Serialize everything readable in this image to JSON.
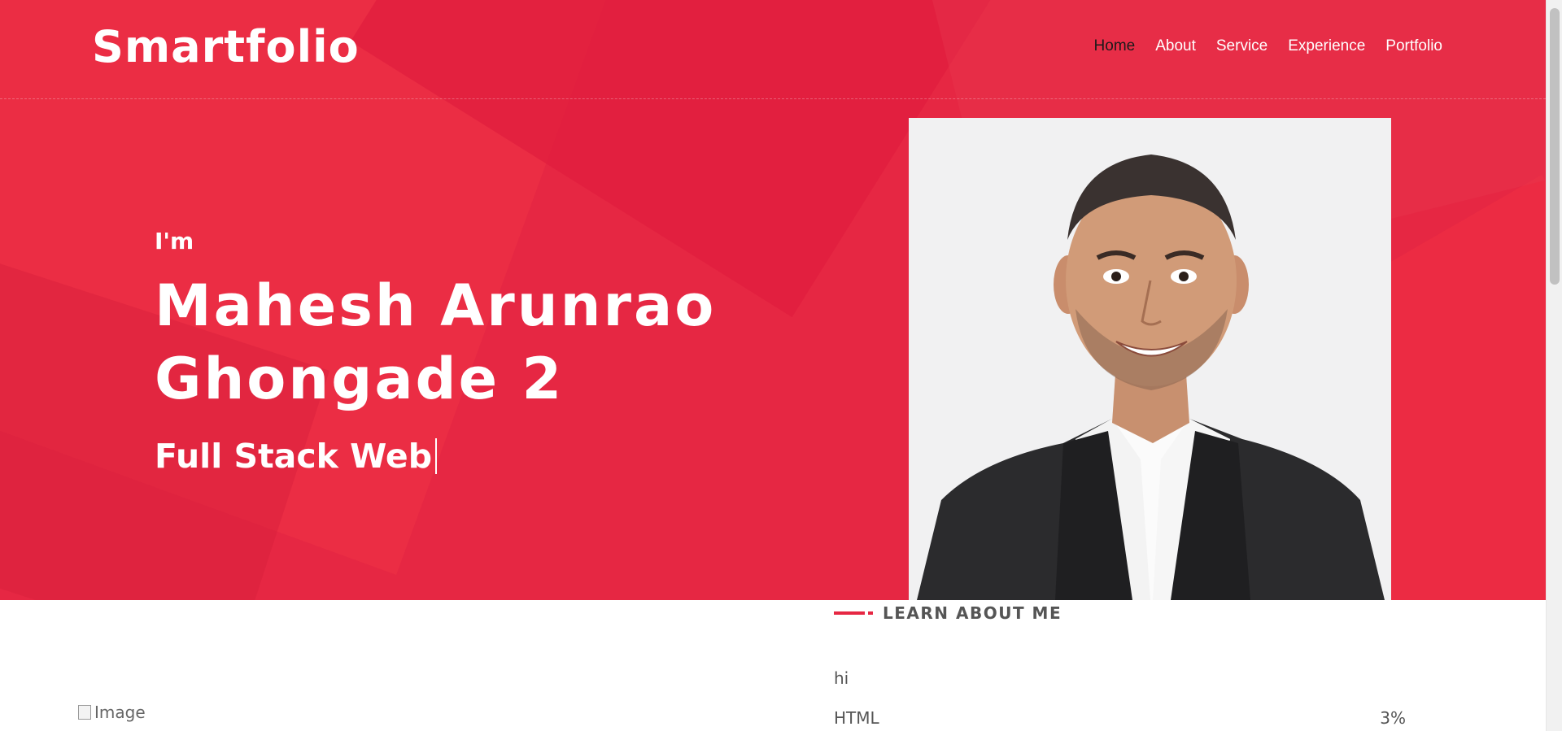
{
  "header": {
    "logo": "Smartfolio",
    "nav": [
      "Home",
      "About",
      "Service",
      "Experience",
      "Portfolio"
    ],
    "active_nav": "Home"
  },
  "hero": {
    "greeting": "I'm",
    "name": "Mahesh Arunrao Ghongade 2",
    "role": "Full Stack Web"
  },
  "about": {
    "section_label": "LEARN ABOUT ME",
    "intro": "hi",
    "skills": [
      {
        "name": "HTML",
        "percent": "3%"
      }
    ],
    "image_alt": "Image"
  },
  "colors": {
    "accent": "#e62743",
    "text_muted": "#555555"
  }
}
